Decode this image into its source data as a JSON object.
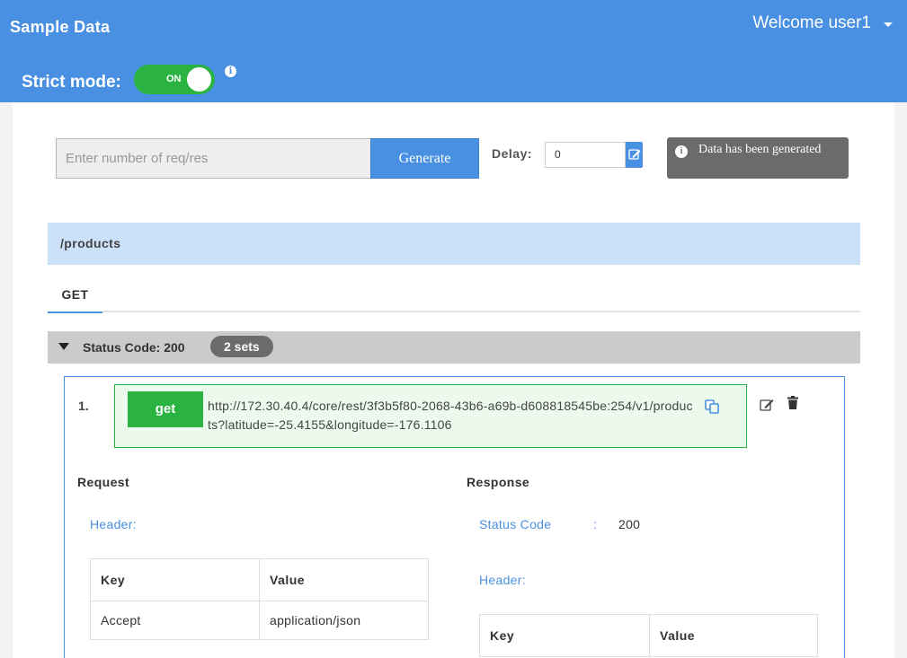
{
  "app": {
    "title": "Sample Data"
  },
  "user_menu": {
    "welcome": "Welcome user1",
    "icon": "chevron-down-icon"
  },
  "strict_mode": {
    "label": "Strict mode:",
    "toggle_text": "ON",
    "state": "on",
    "info_icon": "info-icon"
  },
  "generator": {
    "placeholder": "Enter number of req/res",
    "button_label": "Generate",
    "delay_label": "Delay:",
    "delay_value": "0",
    "delay_edit_icon": "edit-icon"
  },
  "toast": {
    "icon": "info-icon",
    "message": "Data has been generated"
  },
  "endpoint": {
    "path": "/products"
  },
  "tabs": [
    {
      "label": "GET",
      "active": true
    }
  ],
  "status_group": {
    "label": "Status Code: 200",
    "badge": "2 sets",
    "expanded": true
  },
  "records": [
    {
      "index": "1.",
      "method": "get",
      "url": "http://172.30.40.4/core/rest/3f3b5f80-2068-43b6-a69b-d608818545be:254/v1/products?latitude=-25.4155&longitude=-176.1106",
      "request": {
        "title": "Request",
        "header_label": "Header:",
        "columns": [
          "Key",
          "Value"
        ],
        "rows": [
          [
            "Accept",
            "application/json"
          ]
        ]
      },
      "response": {
        "title": "Response",
        "status_label": "Status Code",
        "colon": ":",
        "status_value": "200",
        "header_label": "Header:",
        "columns": [
          "Key",
          "Value"
        ]
      }
    }
  ],
  "colors": {
    "header": "#4a90e2",
    "toggle_on": "#2bb342",
    "endpoint_bar": "#cbe1f9",
    "status_bar": "#cbcbcb",
    "badge": "#6b6b6b",
    "get_method": "#2bb342"
  }
}
